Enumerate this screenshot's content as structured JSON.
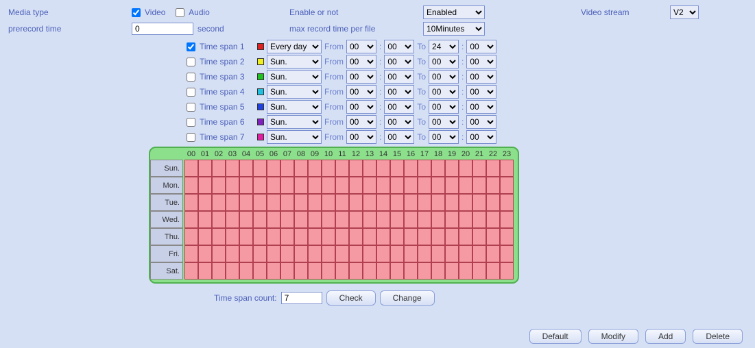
{
  "labels": {
    "media_type": "Media type",
    "prerecord": "prerecord time",
    "video": "Video",
    "audio": "Audio",
    "second": "second",
    "enable": "Enable or not",
    "maxrec": "max record time per file",
    "vstream": "Video stream",
    "from": "From",
    "to": "To",
    "colon": ":",
    "tscount": "Time span count:"
  },
  "top": {
    "video_checked": true,
    "audio_checked": false,
    "prerecord_value": "0",
    "enable_value": "Enabled",
    "maxrec_value": "10Minutes",
    "vstream_value": "V2"
  },
  "timespans": [
    {
      "idx": 1,
      "label": "Time span 1",
      "checked": true,
      "color": "#e02020",
      "day": "Every day",
      "f1": "00",
      "f2": "00",
      "t1": "24",
      "t2": "00"
    },
    {
      "idx": 2,
      "label": "Time span 2",
      "checked": false,
      "color": "#f0f020",
      "day": "Sun.",
      "f1": "00",
      "f2": "00",
      "t1": "00",
      "t2": "00"
    },
    {
      "idx": 3,
      "label": "Time span 3",
      "checked": false,
      "color": "#20c020",
      "day": "Sun.",
      "f1": "00",
      "f2": "00",
      "t1": "00",
      "t2": "00"
    },
    {
      "idx": 4,
      "label": "Time span 4",
      "checked": false,
      "color": "#20c0e0",
      "day": "Sun.",
      "f1": "00",
      "f2": "00",
      "t1": "00",
      "t2": "00"
    },
    {
      "idx": 5,
      "label": "Time span 5",
      "checked": false,
      "color": "#2040e0",
      "day": "Sun.",
      "f1": "00",
      "f2": "00",
      "t1": "00",
      "t2": "00"
    },
    {
      "idx": 6,
      "label": "Time span 6",
      "checked": false,
      "color": "#8020c0",
      "day": "Sun.",
      "f1": "00",
      "f2": "00",
      "t1": "00",
      "t2": "00"
    },
    {
      "idx": 7,
      "label": "Time span 7",
      "checked": false,
      "color": "#e020a0",
      "day": "Sun.",
      "f1": "00",
      "f2": "00",
      "t1": "00",
      "t2": "00"
    }
  ],
  "schedule": {
    "hours": [
      "00",
      "01",
      "02",
      "03",
      "04",
      "05",
      "06",
      "07",
      "08",
      "09",
      "10",
      "11",
      "12",
      "13",
      "14",
      "15",
      "16",
      "17",
      "18",
      "19",
      "20",
      "21",
      "22",
      "23"
    ],
    "days": [
      "Sun.",
      "Mon.",
      "Tue.",
      "Wed.",
      "Thu.",
      "Fri.",
      "Sat."
    ]
  },
  "count": {
    "value": "7"
  },
  "buttons": {
    "check": "Check",
    "change": "Change",
    "default": "Default",
    "modify": "Modify",
    "add": "Add",
    "delete": "Delete"
  }
}
